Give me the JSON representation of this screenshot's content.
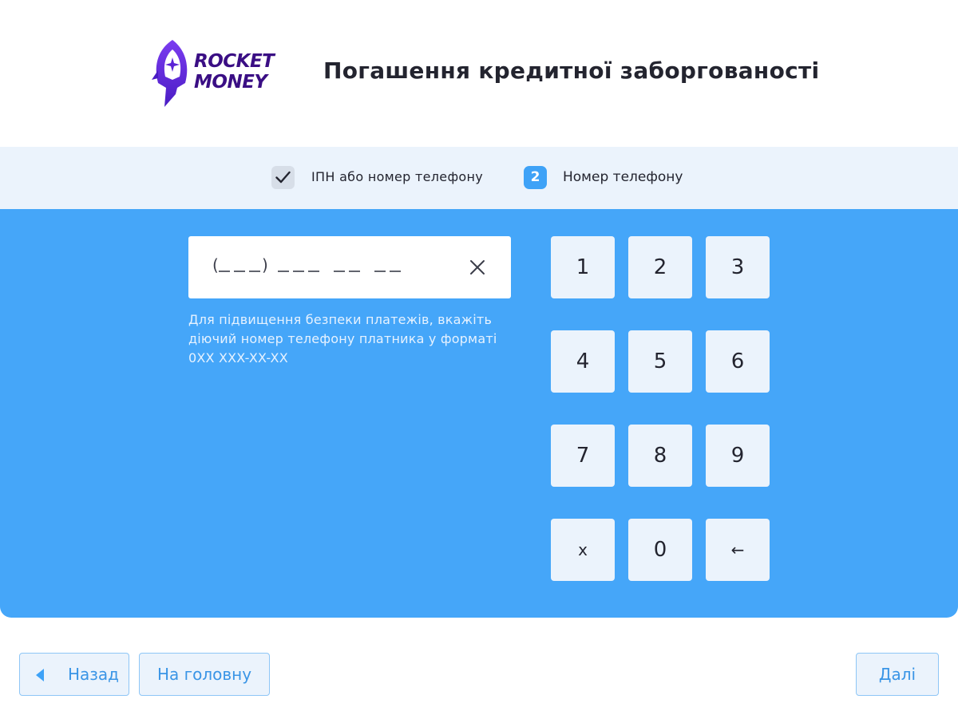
{
  "header": {
    "logo_line1": "ROCKET",
    "logo_line2": "MONEY",
    "title": "Погашення кредитної заборгованості"
  },
  "steps": [
    {
      "label": "ІПН або номер телефону",
      "status": "done"
    },
    {
      "number": "2",
      "label": "Номер телефону",
      "status": "active"
    }
  ],
  "phone": {
    "mask": "(__ __ __) __ __ __  __ __  __ __",
    "hint_lines": [
      "Для підвищення безпеки платежів, вкажіть",
      "діючий номер телефону платника у форматі",
      "0XX XXX-XX-XX"
    ]
  },
  "keypad": [
    [
      "1",
      "2",
      "3"
    ],
    [
      "4",
      "5",
      "6"
    ],
    [
      "7",
      "8",
      "9"
    ],
    [
      "x",
      "0",
      "←"
    ]
  ],
  "nav": {
    "back": "Назад",
    "home": "На головну",
    "next": "Далі"
  },
  "colors": {
    "panel": "#45a6f9",
    "steps_bg": "#ebf3fc",
    "accent": "#3ea2f7",
    "brand": "#3a0e84"
  }
}
